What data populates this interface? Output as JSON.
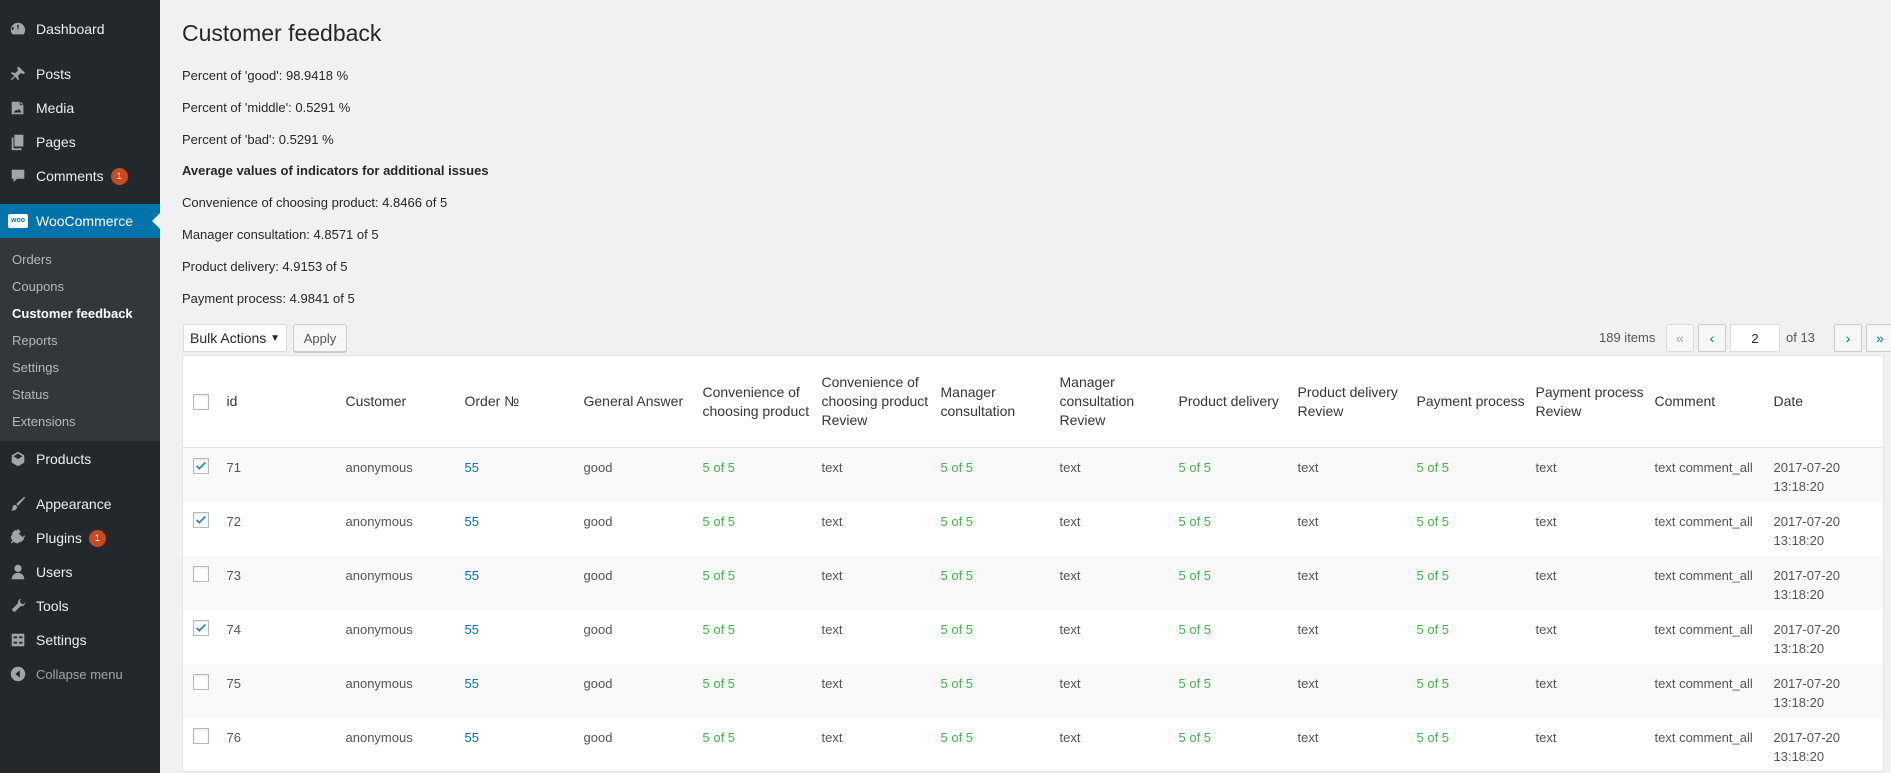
{
  "sidebar": {
    "items": [
      {
        "key": "dashboard",
        "label": "Dashboard",
        "icon": "dashboard-icon"
      },
      {
        "key": "posts",
        "label": "Posts",
        "icon": "pin-icon"
      },
      {
        "key": "media",
        "label": "Media",
        "icon": "media-icon"
      },
      {
        "key": "pages",
        "label": "Pages",
        "icon": "pages-icon"
      },
      {
        "key": "comments",
        "label": "Comments",
        "icon": "comment-icon",
        "badge": "1"
      },
      {
        "key": "woocommerce",
        "label": "WooCommerce",
        "icon": "woo-icon"
      },
      {
        "key": "products",
        "label": "Products",
        "icon": "products-icon"
      },
      {
        "key": "appearance",
        "label": "Appearance",
        "icon": "brush-icon"
      },
      {
        "key": "plugins",
        "label": "Plugins",
        "icon": "plugin-icon",
        "badge": "1"
      },
      {
        "key": "users",
        "label": "Users",
        "icon": "user-icon"
      },
      {
        "key": "tools",
        "label": "Tools",
        "icon": "wrench-icon"
      },
      {
        "key": "settings",
        "label": "Settings",
        "icon": "settings-icon"
      }
    ],
    "woo_icon_text": "woo",
    "submenu": [
      "Orders",
      "Coupons",
      "Customer feedback",
      "Reports",
      "Settings",
      "Status",
      "Extensions"
    ],
    "collapse_label": "Collapse menu"
  },
  "page": {
    "title": "Customer feedback",
    "stats": [
      "Percent of 'good': 98.9418 %",
      "Percent of 'middle': 0.5291 %",
      "Percent of 'bad': 0.5291 %"
    ],
    "avg_heading": "Average values of indicators for additional issues",
    "averages": [
      "Convenience of choosing product: 4.8466 of 5",
      "Manager consultation: 4.8571 of 5",
      "Product delivery: 4.9153 of 5",
      "Payment process: 4.9841 of 5"
    ]
  },
  "tablenav": {
    "bulk_actions": "Bulk Actions",
    "apply": "Apply",
    "items_count": "189 items",
    "first": "«",
    "prev": "‹",
    "current_page": "2",
    "of_pages": "of 13",
    "next": "›",
    "last": "»"
  },
  "table": {
    "columns": [
      "id",
      "Customer",
      "Order №",
      "General Answer",
      "Convenience of choosing product",
      "Convenience of choosing product Review",
      "Manager consultation",
      "Manager consultation Review",
      "Product delivery",
      "Product delivery Review",
      "Payment process",
      "Payment process Review",
      "Comment",
      "Date"
    ],
    "rows": [
      {
        "checked": true,
        "cells": [
          "71",
          "anonymous",
          "55",
          "good",
          "5 of 5",
          "text",
          "5 of 5",
          "text",
          "5 of 5",
          "text",
          "5 of 5",
          "text",
          "text comment_all",
          "2017-07-20 13:18:20"
        ]
      },
      {
        "checked": true,
        "cells": [
          "72",
          "anonymous",
          "55",
          "good",
          "5 of 5",
          "text",
          "5 of 5",
          "text",
          "5 of 5",
          "text",
          "5 of 5",
          "text",
          "text comment_all",
          "2017-07-20 13:18:20"
        ]
      },
      {
        "checked": false,
        "cells": [
          "73",
          "anonymous",
          "55",
          "good",
          "5 of 5",
          "text",
          "5 of 5",
          "text",
          "5 of 5",
          "text",
          "5 of 5",
          "text",
          "text comment_all",
          "2017-07-20 13:18:20"
        ]
      },
      {
        "checked": true,
        "cells": [
          "74",
          "anonymous",
          "55",
          "good",
          "5 of 5",
          "text",
          "5 of 5",
          "text",
          "5 of 5",
          "text",
          "5 of 5",
          "text",
          "text comment_all",
          "2017-07-20 13:18:20"
        ]
      },
      {
        "checked": false,
        "cells": [
          "75",
          "anonymous",
          "55",
          "good",
          "5 of 5",
          "text",
          "5 of 5",
          "text",
          "5 of 5",
          "text",
          "5 of 5",
          "text",
          "text comment_all",
          "2017-07-20 13:18:20"
        ]
      },
      {
        "checked": false,
        "cells": [
          "76",
          "anonymous",
          "55",
          "good",
          "5 of 5",
          "text",
          "5 of 5",
          "text",
          "5 of 5",
          "text",
          "5 of 5",
          "text",
          "text comment_all",
          "2017-07-20 13:18:20"
        ]
      }
    ]
  },
  "colors": {
    "accent": "#0073aa",
    "sidebar": "#23282d",
    "submenu": "#32373c",
    "badge": "#ca4a1f",
    "rating": "#46b450"
  }
}
